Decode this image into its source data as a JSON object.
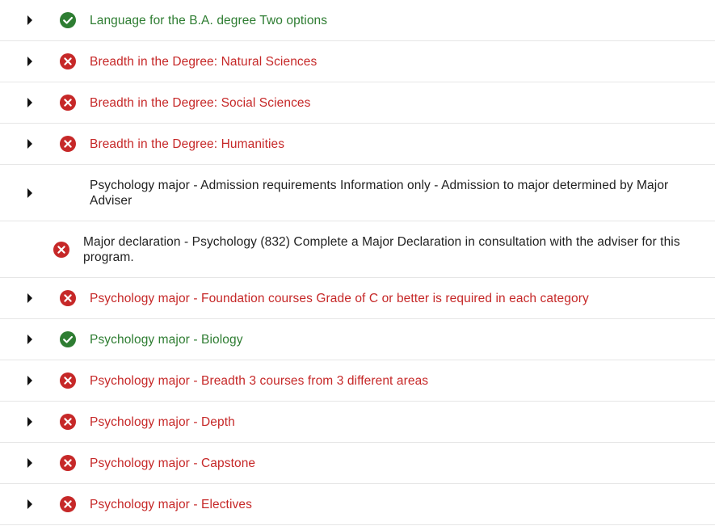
{
  "colors": {
    "ok": "#2e7d32",
    "fail": "#c62828",
    "neutral": "#212121",
    "divider": "#e6e6e6"
  },
  "requirements": [
    {
      "label": "Language for the B.A. degree Two options",
      "status": "ok",
      "expandable": true,
      "icon": "check-circle-icon"
    },
    {
      "label": "Breadth in the Degree: Natural Sciences",
      "status": "fail",
      "expandable": true,
      "icon": "x-circle-icon"
    },
    {
      "label": "Breadth in the Degree: Social Sciences",
      "status": "fail",
      "expandable": true,
      "icon": "x-circle-icon"
    },
    {
      "label": "Breadth in the Degree: Humanities",
      "status": "fail",
      "expandable": true,
      "icon": "x-circle-icon"
    },
    {
      "label": "Psychology major - Admission requirements Information only - Admission to major determined by Major Adviser",
      "status": "info",
      "expandable": true,
      "icon": ""
    },
    {
      "label": "Major declaration - Psychology (832) Complete a Major Declaration in consultation with the adviser for this program.",
      "status": "info",
      "expandable": false,
      "icon": "x-circle-icon"
    },
    {
      "label": "Psychology major - Foundation courses Grade of C or better is required in each category",
      "status": "fail",
      "expandable": true,
      "icon": "x-circle-icon"
    },
    {
      "label": "Psychology major - Biology",
      "status": "ok",
      "expandable": true,
      "icon": "check-circle-icon"
    },
    {
      "label": "Psychology major - Breadth 3 courses from 3 different areas",
      "status": "fail",
      "expandable": true,
      "icon": "x-circle-icon"
    },
    {
      "label": "Psychology major - Depth",
      "status": "fail",
      "expandable": true,
      "icon": "x-circle-icon"
    },
    {
      "label": "Psychology major - Capstone",
      "status": "fail",
      "expandable": true,
      "icon": "x-circle-icon"
    },
    {
      "label": "Psychology major - Electives",
      "status": "fail",
      "expandable": true,
      "icon": "x-circle-icon"
    }
  ]
}
